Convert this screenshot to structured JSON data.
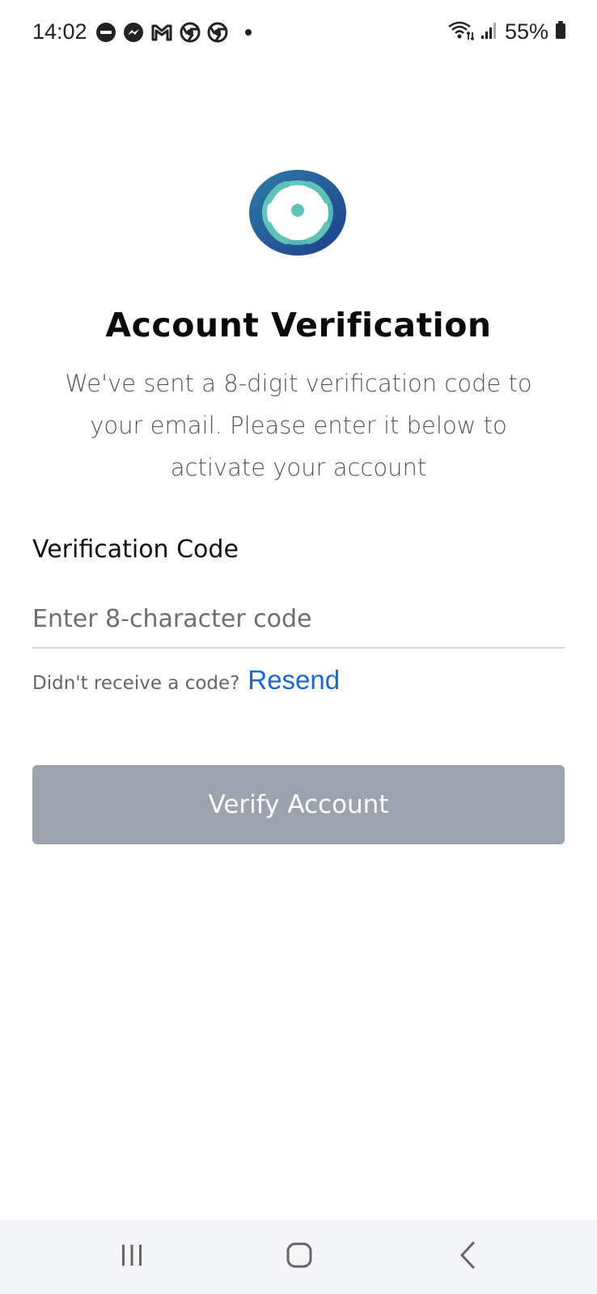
{
  "status_bar": {
    "time": "14:02",
    "battery_percent": "55%",
    "notification_icons": [
      "do-not-disturb-icon",
      "messenger-icon",
      "gmail-icon",
      "chrome-icon",
      "chrome-icon",
      "more-dot-icon"
    ],
    "right_icons": [
      "wifi-icon",
      "signal-icon",
      "battery-icon"
    ]
  },
  "brand": {
    "logo_icon": "app-logo-icon",
    "colors": {
      "logo_outer": "#1f4f96",
      "logo_inner": "#5cc3b5",
      "accent_link": "#1a66d6",
      "button_disabled": "#9ba3af"
    }
  },
  "page": {
    "title": "Account Verification",
    "subtitle": "We've sent a 8-digit verification code to your email. Please enter it below to activate your account"
  },
  "form": {
    "code_label": "Verification Code",
    "code_value": "",
    "code_placeholder": "Enter 8-character code",
    "resend_prompt": "Didn't receive a code?",
    "resend_link": "Resend",
    "submit_label": "Verify Account"
  },
  "nav_bar": {
    "icons": [
      "recents-icon",
      "home-icon",
      "back-icon"
    ]
  }
}
